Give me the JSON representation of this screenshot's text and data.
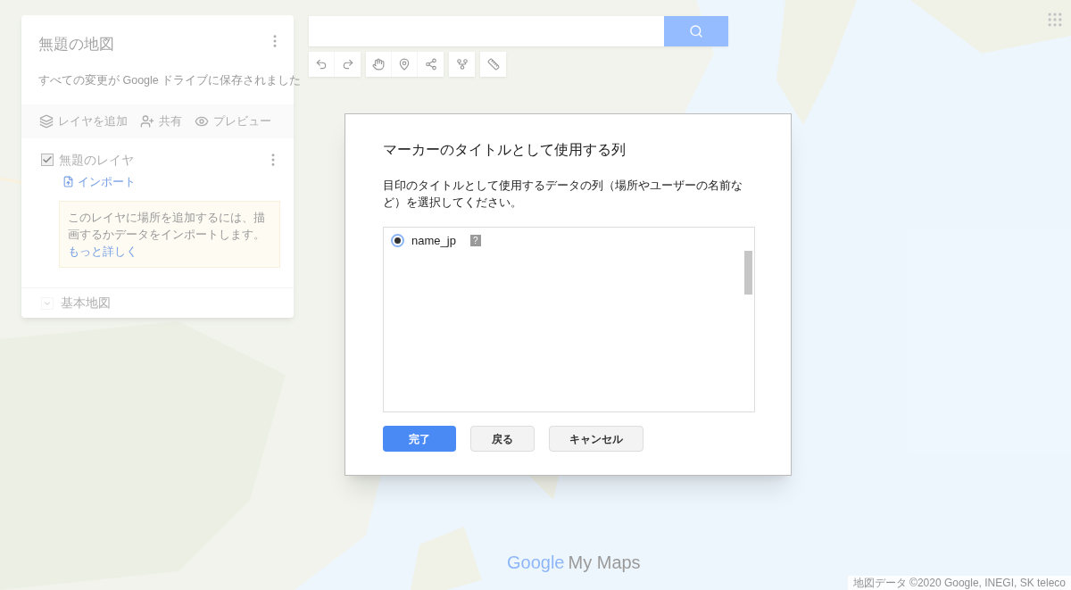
{
  "map_panel": {
    "title": "無題の地図",
    "subtitle": "すべての変更が Google ドライブに保存されました",
    "actions": [
      {
        "kind": "layers",
        "label": "レイヤを追加"
      },
      {
        "kind": "share",
        "label": "共有"
      },
      {
        "kind": "preview",
        "label": "プレビュー"
      }
    ],
    "layers": [
      {
        "name": "無題のレイヤ",
        "checked": true,
        "import_link": "インポート",
        "hint": {
          "text": "このレイヤに場所を追加するには、描画するかデータをインポートします。",
          "link": "もっと詳しく"
        }
      }
    ],
    "base_map": {
      "label": "基本地図",
      "expanded": false
    }
  },
  "dialog": {
    "title": "マーカーのタイトルとして使用する列",
    "description": "目印のタイトルとして使用するデータの列（場所やユーザーの名前など）を選択してください。",
    "options": [
      {
        "label": "name_jp",
        "selected": true,
        "help_mark": "?"
      }
    ],
    "buttons": [
      {
        "label": "完了",
        "kind": "primary"
      },
      {
        "label": "戻る",
        "kind": "secondary"
      },
      {
        "label": "キャンセル",
        "kind": "secondary"
      }
    ]
  },
  "logo": {
    "brand": "Google",
    "product": "My Maps"
  },
  "attribution": "地図データ ©2020 Google, INEGI, SK teleco"
}
